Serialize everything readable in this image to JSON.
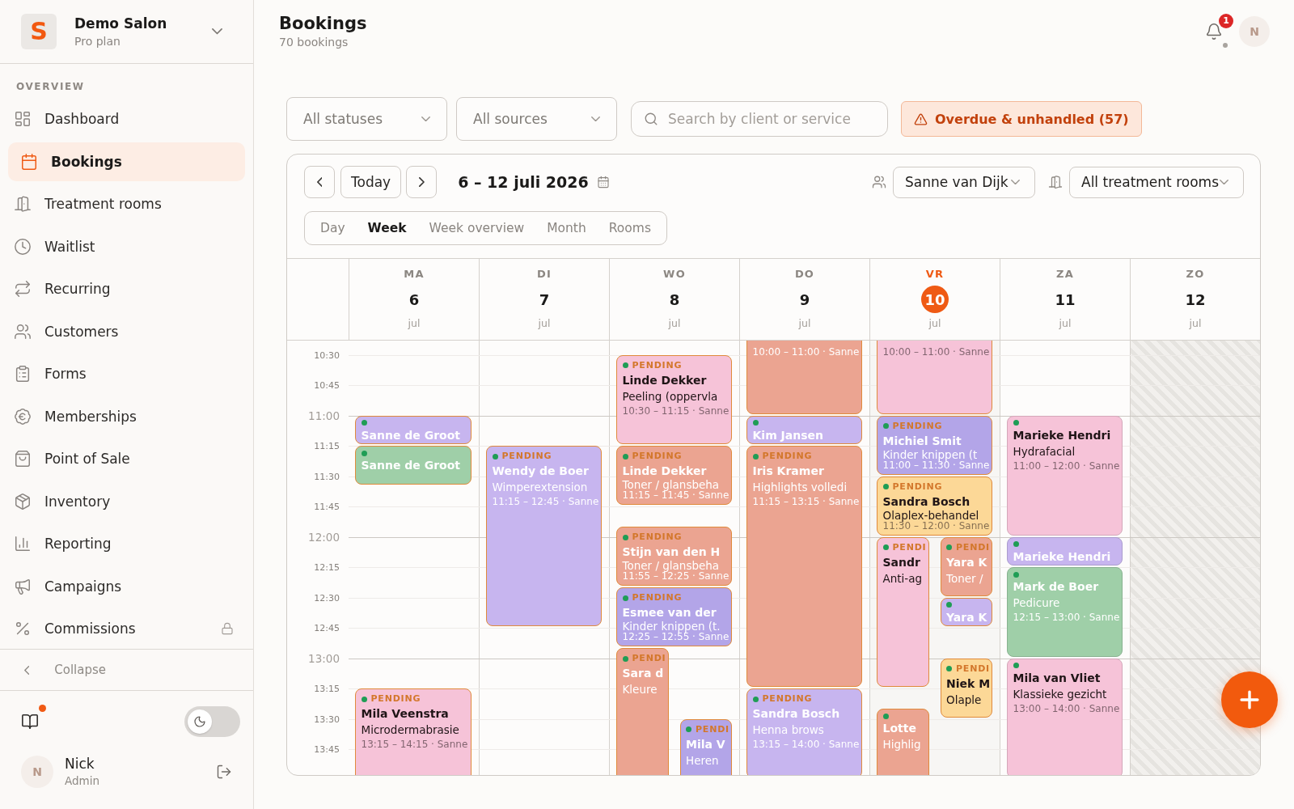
{
  "sidebar": {
    "workspace": {
      "logo": "S",
      "name": "Demo Salon",
      "plan": "Pro plan"
    },
    "section": "OVERVIEW",
    "items": [
      {
        "label": "Dashboard",
        "selected": false,
        "locked": false
      },
      {
        "label": "Bookings",
        "selected": true,
        "locked": false
      },
      {
        "label": "Treatment rooms",
        "selected": false,
        "locked": false
      },
      {
        "label": "Waitlist",
        "selected": false,
        "locked": false
      },
      {
        "label": "Recurring",
        "selected": false,
        "locked": false
      },
      {
        "label": "Customers",
        "selected": false,
        "locked": false
      },
      {
        "label": "Forms",
        "selected": false,
        "locked": false
      },
      {
        "label": "Memberships",
        "selected": false,
        "locked": false
      },
      {
        "label": "Point of Sale",
        "selected": false,
        "locked": false
      },
      {
        "label": "Inventory",
        "selected": false,
        "locked": false
      },
      {
        "label": "Reporting",
        "selected": false,
        "locked": false
      },
      {
        "label": "Campaigns",
        "selected": false,
        "locked": false
      },
      {
        "label": "Commissions",
        "selected": false,
        "locked": true
      }
    ],
    "collapse": "Collapse",
    "guide": {
      "unread": true
    },
    "dark_mode": {
      "on": false
    },
    "user": {
      "initial": "N",
      "name": "Nick",
      "role": "Admin"
    }
  },
  "header": {
    "title": "Bookings",
    "subtitle": "70 bookings",
    "notifications": "1",
    "avatar": "N"
  },
  "filters": {
    "status": "All statuses",
    "source": "All sources",
    "search": {
      "placeholder": "Search by client or service"
    },
    "overdue": "Overdue & unhandled (57)"
  },
  "calendar": {
    "today_button": "Today",
    "range": "6 – 12 juli 2026",
    "staff": "Sanne van Dijk",
    "rooms": "All treatment rooms",
    "views": [
      {
        "label": "Day",
        "selected": false
      },
      {
        "label": "Week",
        "selected": true
      },
      {
        "label": "Week overview",
        "selected": false
      },
      {
        "label": "Month",
        "selected": false
      },
      {
        "label": "Rooms",
        "selected": false
      }
    ],
    "time_slots": [
      {
        "label": "10:30",
        "kind": "quarter"
      },
      {
        "label": "10:45",
        "kind": "quarter"
      },
      {
        "label": "11:00",
        "kind": "hour"
      },
      {
        "label": "11:15",
        "kind": "quarter"
      },
      {
        "label": "11:30",
        "kind": "quarter"
      },
      {
        "label": "11:45",
        "kind": "quarter"
      },
      {
        "label": "12:00",
        "kind": "hour"
      },
      {
        "label": "12:15",
        "kind": "quarter"
      },
      {
        "label": "12:30",
        "kind": "quarter"
      },
      {
        "label": "12:45",
        "kind": "quarter"
      },
      {
        "label": "13:00",
        "kind": "hour"
      },
      {
        "label": "13:15",
        "kind": "quarter"
      },
      {
        "label": "13:30",
        "kind": "quarter"
      },
      {
        "label": "13:45",
        "kind": "quarter"
      }
    ],
    "days": [
      {
        "weekday": "MA",
        "date": "6",
        "month": "jul",
        "today": false,
        "closed": false,
        "events": [
          {
            "name": "Sanne de Groot",
            "color": "#c7b5ef",
            "overdue": true
          },
          {
            "name": "Sanne de Groot",
            "color": "#9fcfa8",
            "overdue": true
          },
          {
            "status": "PENDING",
            "name": "Mila Veenstra",
            "service": "Microdermabrasie",
            "time": "13:15 – 14:15 · Sanne",
            "color": "#f6c3d8",
            "overdue": true
          }
        ]
      },
      {
        "weekday": "DI",
        "date": "7",
        "month": "jul",
        "today": false,
        "closed": false,
        "events": [
          {
            "status": "PENDING",
            "name": "Wendy de Boer",
            "service": "Wimperextension",
            "time": "11:15 – 12:45 · Sanne",
            "color": "#c7b5ef",
            "overdue": true
          }
        ]
      },
      {
        "weekday": "WO",
        "date": "8",
        "month": "jul",
        "today": false,
        "closed": false,
        "events": [
          {
            "status": "PENDING",
            "name": "Linde Dekker",
            "service": "Peeling (oppervla",
            "time": "10:30 – 11:15 · Sanne",
            "color": "#f6c3d8",
            "overdue": true
          },
          {
            "status": "PENDING",
            "name": "Linde Dekker",
            "service": "Toner / glansbeha",
            "time": "11:15 – 11:45 · Sanne",
            "color": "#eba491",
            "overdue": true
          },
          {
            "status": "PENDING",
            "name": "Stijn van den H",
            "service": "Toner / glansbeha",
            "time": "11:55 – 12:25 · Sanne",
            "color": "#eba491",
            "overdue": true
          },
          {
            "status": "PENDING",
            "name": "Esmee van der",
            "service": "Kinder knippen (t.",
            "time": "12:25 – 12:55 · Sanne",
            "color": "#b3a5e8",
            "overdue": true
          },
          {
            "status": "PENDI",
            "name": "Sara d",
            "service": "Kleure",
            "color": "#eba491",
            "overdue": true
          },
          {
            "status": "PENDI",
            "name": "Mila V",
            "service": "Heren",
            "color": "#b3a5e8",
            "overdue": true
          }
        ]
      },
      {
        "weekday": "DO",
        "date": "9",
        "month": "jul",
        "today": false,
        "closed": false,
        "events": [
          {
            "time": "10:00 – 11:00 · Sanne",
            "color": "#eba491",
            "overdue": true
          },
          {
            "name": "Kim Jansen",
            "color": "#c7b5ef",
            "overdue": true
          },
          {
            "status": "PENDING",
            "name": "Iris Kramer",
            "service": "Highlights volledi",
            "time": "11:15 – 13:15 · Sanne",
            "color": "#eba491",
            "overdue": true
          },
          {
            "status": "PENDING",
            "name": "Sandra Bosch",
            "service": "Henna brows",
            "time": "13:15 – 14:00 · Sanne",
            "color": "#c7b5ef",
            "overdue": true
          }
        ]
      },
      {
        "weekday": "VR",
        "date": "10",
        "month": "jul",
        "today": true,
        "closed": false,
        "events": [
          {
            "time": "10:00 – 11:00 · Sanne",
            "color": "#f6c3d8",
            "overdue": true
          },
          {
            "status": "PENDING",
            "name": "Michiel Smit",
            "service": "Kinder knippen (t",
            "time": "11:00 – 11:30 · Sanne",
            "color": "#b3a5e8",
            "overdue": true
          },
          {
            "status": "PENDING",
            "name": "Sandra Bosch",
            "service": "Olaplex-behandel",
            "time": "11:30 – 12:00 · Sanne",
            "color": "#fcd897",
            "overdue": true
          },
          {
            "status": "PENDI",
            "name": "Sandr",
            "service": "Anti-ag",
            "color": "#f6c3d8",
            "overdue": true
          },
          {
            "status": "PENDI",
            "name": "Yara K",
            "service": "Toner /",
            "color": "#eba491",
            "overdue": true
          },
          {
            "name": "Yara K",
            "color": "#c7b5ef",
            "overdue": true
          },
          {
            "status": "PENDI",
            "name": "Niek M",
            "service": "Olaple",
            "color": "#fcd897",
            "overdue": true
          },
          {
            "name": "Lotte",
            "service": "Highlig",
            "color": "#eba491",
            "overdue": true
          }
        ]
      },
      {
        "weekday": "ZA",
        "date": "11",
        "month": "jul",
        "today": false,
        "closed": false,
        "events": [
          {
            "name": "Marieke Hendri",
            "service": "Hydrafacial",
            "time": "11:00 – 12:00 · Sanne",
            "color": "#f6c3d8",
            "overdue": false
          },
          {
            "name": "Marieke Hendri",
            "color": "#c7b5ef",
            "overdue": false
          },
          {
            "name": "Mark de Boer",
            "service": "Pedicure",
            "time": "12:15 – 13:00 · Sanne",
            "color": "#9fcfa8",
            "overdue": false
          },
          {
            "name": "Mila van Vliet",
            "service": "Klassieke gezicht",
            "time": "13:00 – 14:00 · Sanne",
            "color": "#f6c3d8",
            "overdue": false
          }
        ]
      },
      {
        "weekday": "ZO",
        "date": "12",
        "month": "jul",
        "today": false,
        "closed": true
      }
    ]
  }
}
